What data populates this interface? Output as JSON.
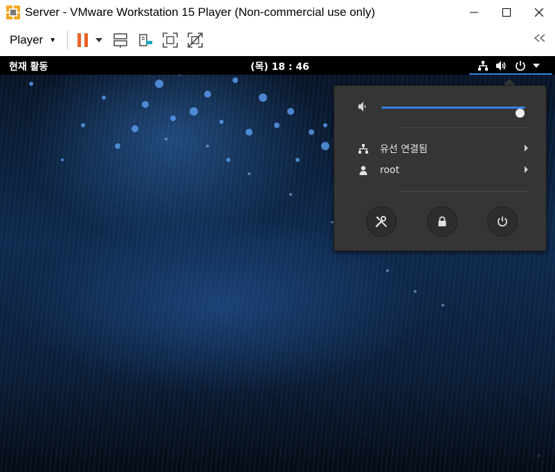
{
  "window": {
    "title": "Server - VMware Workstation 15 Player (Non-commercial use only)"
  },
  "toolbar": {
    "player_label": "Player"
  },
  "gnome_bar": {
    "activities_label": "현재 활동",
    "clock": "(목) 18 : 46"
  },
  "system_menu": {
    "volume_level": 0.96,
    "network_label": "유선 연결됨",
    "user_label": "root",
    "buttons": [
      "settings-icon",
      "lock-icon",
      "power-icon"
    ]
  },
  "colors": {
    "accent": "#3584e4",
    "pause_orange": "#e8632a",
    "popup_bg": "#353535"
  }
}
